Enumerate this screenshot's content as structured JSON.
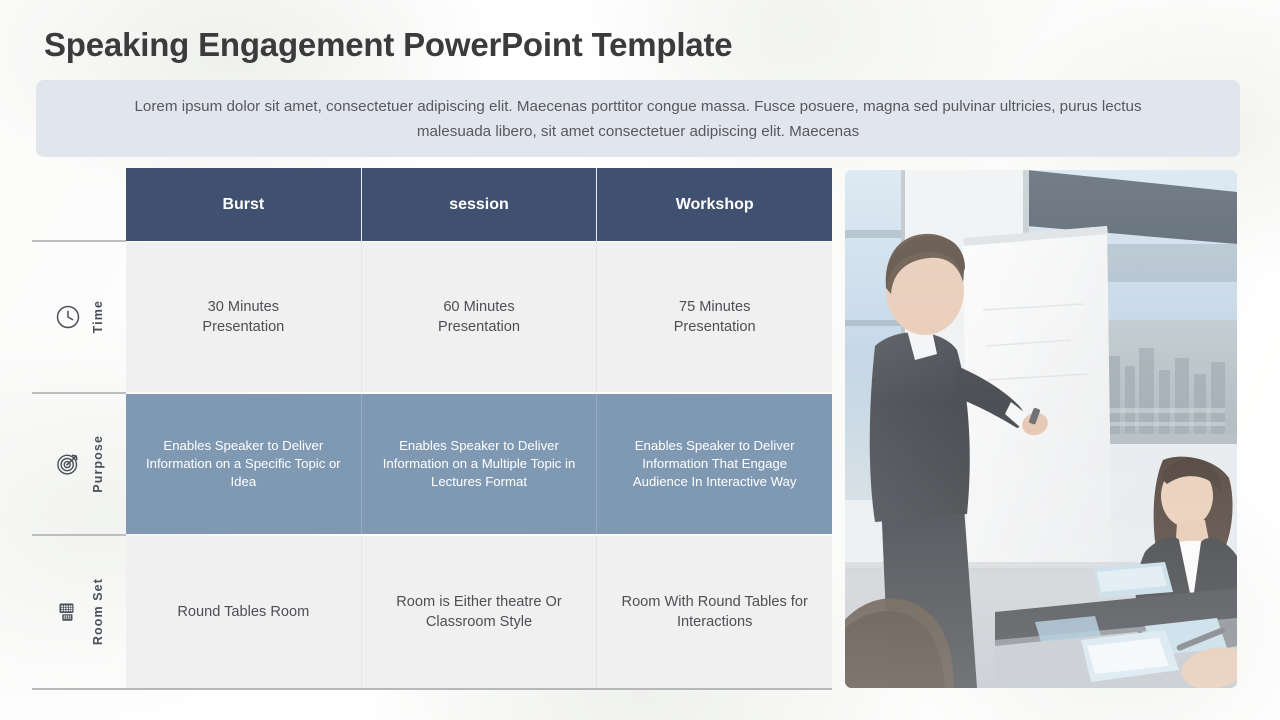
{
  "slide": {
    "title": "Speaking Engagement PowerPoint Template",
    "subtitle": "Lorem ipsum dolor sit amet, consectetuer adipiscing elit. Maecenas porttitor congue massa. Fusce posuere, magna sed pulvinar ultricies, purus lectus malesuada libero, sit amet consectetuer adipiscing elit. Maecenas"
  },
  "colors": {
    "header_bg": "#3f5070",
    "accent_row_bg": "#8099b3",
    "light_row_bg": "#f0f0f0",
    "subtitle_bg": "#e1e5ed",
    "title_text": "#3b3b3b"
  },
  "table": {
    "columns": [
      {
        "label": "Burst"
      },
      {
        "label": "session"
      },
      {
        "label": "Workshop"
      }
    ],
    "rows": [
      {
        "label": "Time",
        "icon": "clock-icon",
        "style": "light",
        "cells": [
          "30 Minutes\nPresentation",
          "60 Minutes\nPresentation",
          "75 Minutes\nPresentation"
        ]
      },
      {
        "label": "Purpose",
        "icon": "target-icon",
        "style": "accent",
        "cells": [
          "Enables Speaker to Deliver Information on a Specific Topic or Idea",
          "Enables Speaker to Deliver Information on a Multiple Topic in Lectures Format",
          "Enables Speaker to Deliver Information That Engage Audience In Interactive Way"
        ]
      },
      {
        "label": "Room Set",
        "icon": "room-layout-icon",
        "style": "light",
        "cells": [
          "Round Tables Room",
          "Room is Either theatre Or Classroom Style",
          "Room With Round Tables for Interactions"
        ]
      }
    ]
  },
  "photo": {
    "alt": "business-presentation-photo"
  }
}
